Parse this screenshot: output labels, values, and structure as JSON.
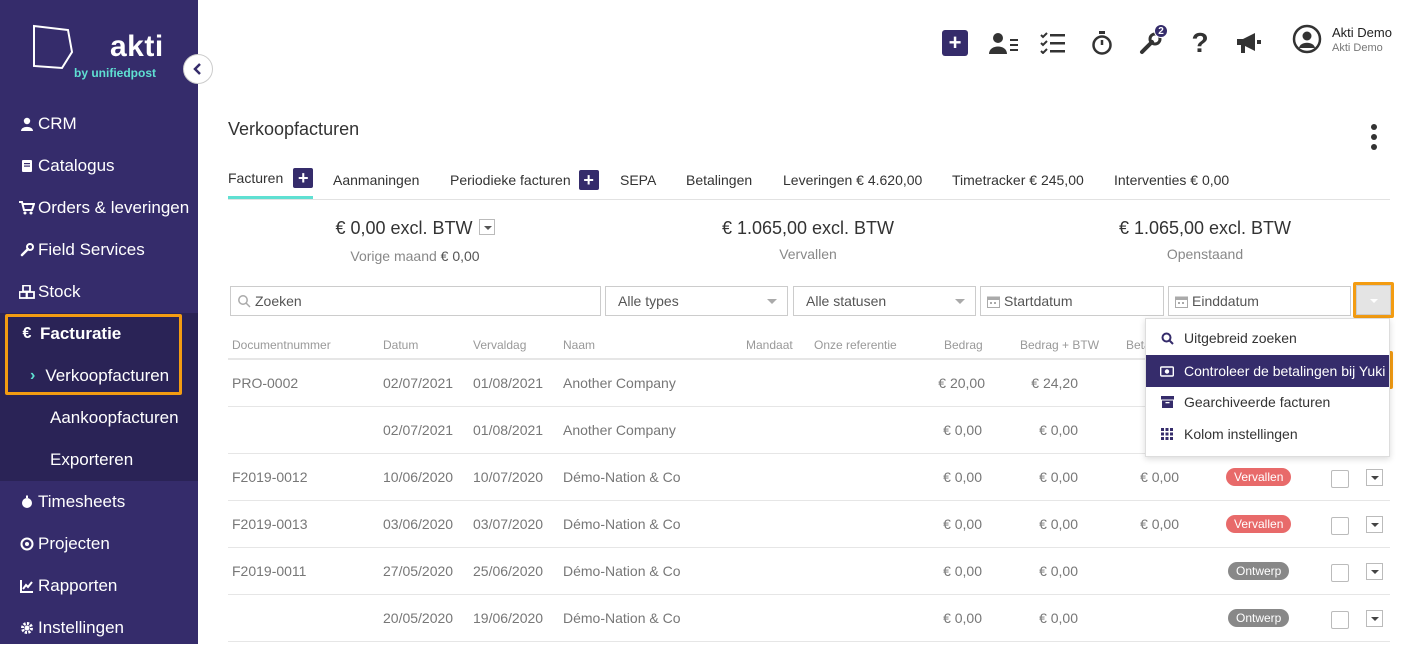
{
  "brand": {
    "name": "akti",
    "tagline": "by unifiedpost"
  },
  "sidebar": {
    "items": [
      {
        "label": "CRM",
        "icon": "user-icon"
      },
      {
        "label": "Catalogus",
        "icon": "book-icon"
      },
      {
        "label": "Orders & leveringen",
        "icon": "cart-icon"
      },
      {
        "label": "Field Services",
        "icon": "wrench-icon"
      },
      {
        "label": "Stock",
        "icon": "cubes-icon"
      },
      {
        "label": "Facturatie",
        "icon": "euro-icon"
      },
      {
        "label": "Timesheets",
        "icon": "stopwatch-icon"
      },
      {
        "label": "Projecten",
        "icon": "target-icon"
      },
      {
        "label": "Rapporten",
        "icon": "chart-icon"
      },
      {
        "label": "Instellingen",
        "icon": "gear-icon"
      }
    ],
    "facturatie_sub": [
      "Verkoopfacturen",
      "Aankoopfacturen",
      "Exporteren"
    ],
    "euro_symbol": "€"
  },
  "topbar": {
    "notification_count": "2",
    "user_name": "Akti Demo",
    "user_company": "Akti Demo"
  },
  "page": {
    "title": "Verkoopfacturen"
  },
  "tabs": [
    {
      "label": "Facturen"
    },
    {
      "label": "Aanmaningen"
    },
    {
      "label": "Periodieke facturen"
    },
    {
      "label": "SEPA"
    },
    {
      "label": "Betalingen"
    },
    {
      "label": "Leveringen € 4.620,00"
    },
    {
      "label": "Timetracker € 245,00"
    },
    {
      "label": "Interventies € 0,00"
    }
  ],
  "summary": [
    {
      "amount": "€ 0,00 excl. BTW",
      "label": "Vorige maand",
      "label_value": "€ 0,00"
    },
    {
      "amount": "€ 1.065,00 excl. BTW",
      "label": "Vervallen"
    },
    {
      "amount": "€ 1.065,00 excl. BTW",
      "label": "Openstaand"
    }
  ],
  "filters": {
    "search_placeholder": "Zoeken",
    "types": "Alle types",
    "statuses": "Alle statusen",
    "start_date": "Startdatum",
    "end_date": "Einddatum"
  },
  "table": {
    "columns": [
      "Documentnummer",
      "Datum",
      "Vervaldag",
      "Naam",
      "Mandaat",
      "Onze referentie",
      "Bedrag",
      "Bedrag + BTW",
      "Betaald"
    ],
    "rows": [
      {
        "doc": "PRO-0002",
        "date": "02/07/2021",
        "due": "01/08/2021",
        "name": "Another Company",
        "amount": "€ 20,00",
        "amount_vat": "€ 24,20",
        "paid": "",
        "status": ""
      },
      {
        "doc": "",
        "date": "02/07/2021",
        "due": "01/08/2021",
        "name": "Another Company",
        "amount": "€ 0,00",
        "amount_vat": "€ 0,00",
        "paid": "",
        "status": ""
      },
      {
        "doc": "F2019-0012",
        "date": "10/06/2020",
        "due": "10/07/2020",
        "name": "Démo-Nation & Co",
        "amount": "€ 0,00",
        "amount_vat": "€ 0,00",
        "paid": "€ 0,00",
        "status": "Vervallen"
      },
      {
        "doc": "F2019-0013",
        "date": "03/06/2020",
        "due": "03/07/2020",
        "name": "Démo-Nation & Co",
        "amount": "€ 0,00",
        "amount_vat": "€ 0,00",
        "paid": "€ 0,00",
        "status": "Vervallen"
      },
      {
        "doc": "F2019-0011",
        "date": "27/05/2020",
        "due": "25/06/2020",
        "name": "Démo-Nation & Co",
        "amount": "€ 0,00",
        "amount_vat": "€ 0,00",
        "paid": "",
        "status": "Ontwerp"
      },
      {
        "doc": "",
        "date": "20/05/2020",
        "due": "19/06/2020",
        "name": "Démo-Nation & Co",
        "amount": "€ 0,00",
        "amount_vat": "€ 0,00",
        "paid": "",
        "status": "Ontwerp"
      }
    ]
  },
  "menu": {
    "items": [
      {
        "label": "Uitgebreid zoeken",
        "icon": "search-icon"
      },
      {
        "label": "Controleer de betalingen bij Yuki",
        "icon": "money-icon"
      },
      {
        "label": "Gearchiveerde facturen",
        "icon": "archive-icon"
      },
      {
        "label": "Kolom instellingen",
        "icon": "grid-icon"
      }
    ]
  },
  "colors": {
    "brand": "#352c6b",
    "accent": "#5fe0d2",
    "highlight": "#f39c12",
    "status_overdue": "#e86a6a",
    "status_draft": "#888888"
  }
}
